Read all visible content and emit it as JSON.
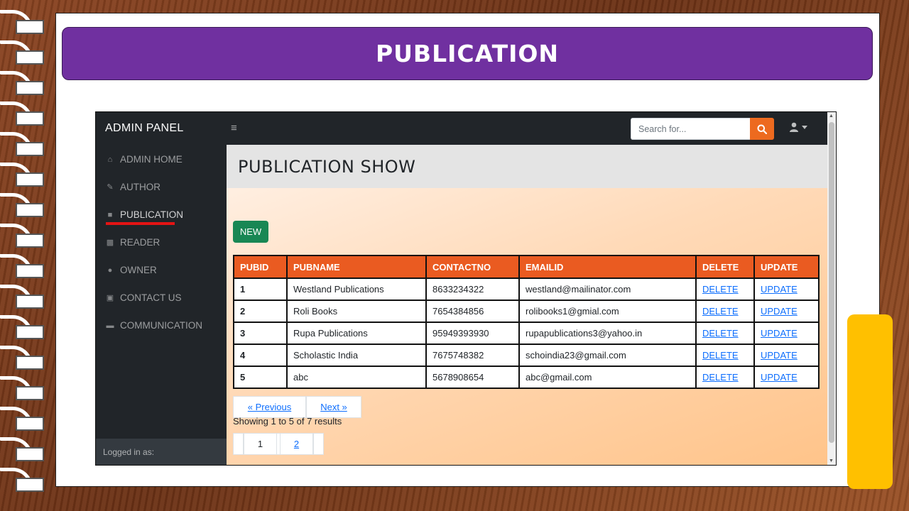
{
  "slide": {
    "title": "PUBLICATION"
  },
  "app": {
    "brand": "ADMIN PANEL",
    "menu_toggle": "≡",
    "search": {
      "placeholder": "Search for..."
    },
    "sidebar": {
      "items": [
        {
          "label": "ADMIN HOME",
          "icon": "home-icon"
        },
        {
          "label": "AUTHOR",
          "icon": "pen-icon"
        },
        {
          "label": "PUBLICATION",
          "icon": "book-icon",
          "active": true
        },
        {
          "label": "READER",
          "icon": "reader-icon"
        },
        {
          "label": "OWNER",
          "icon": "user-icon"
        },
        {
          "label": "CONTACT US",
          "icon": "contact-card-icon"
        },
        {
          "label": "COMMUNICATION",
          "icon": "chat-icon"
        }
      ],
      "footer": "Logged in as:"
    },
    "page_title": "PUBLICATION SHOW",
    "new_button": "NEW",
    "table": {
      "headers": [
        "PUBID",
        "PUBNAME",
        "CONTACTNO",
        "EMAILID",
        "DELETE",
        "UPDATE"
      ],
      "rows": [
        {
          "id": "1",
          "name": "Westland Publications",
          "contact": "8633234322",
          "email": "westland@mailinator.com",
          "delete": "DELETE",
          "update": "UPDATE"
        },
        {
          "id": "2",
          "name": "Roli Books",
          "contact": "7654384856",
          "email": "rolibooks1@gmial.com",
          "delete": "DELETE",
          "update": "UPDATE"
        },
        {
          "id": "3",
          "name": "Rupa Publications",
          "contact": "95949393930",
          "email": "rupapublications3@yahoo.in",
          "delete": "DELETE",
          "update": "UPDATE"
        },
        {
          "id": "4",
          "name": "Scholastic India",
          "contact": "7675748382",
          "email": "schoindia23@gmail.com",
          "delete": "DELETE",
          "update": "UPDATE"
        },
        {
          "id": "5",
          "name": "abc",
          "contact": "5678908654",
          "email": "abc@gmail.com",
          "delete": "DELETE",
          "update": "UPDATE"
        }
      ]
    },
    "pagination": {
      "previous": "« Previous",
      "next": "Next »",
      "summary": "Showing 1 to 5 of 7 results",
      "pages": [
        "1",
        "2"
      ],
      "current_page": "1"
    }
  },
  "colors": {
    "banner": "#7030a0",
    "accent_orange": "#ea5b21",
    "new_button": "#198754",
    "side_card": "#ffc000"
  }
}
